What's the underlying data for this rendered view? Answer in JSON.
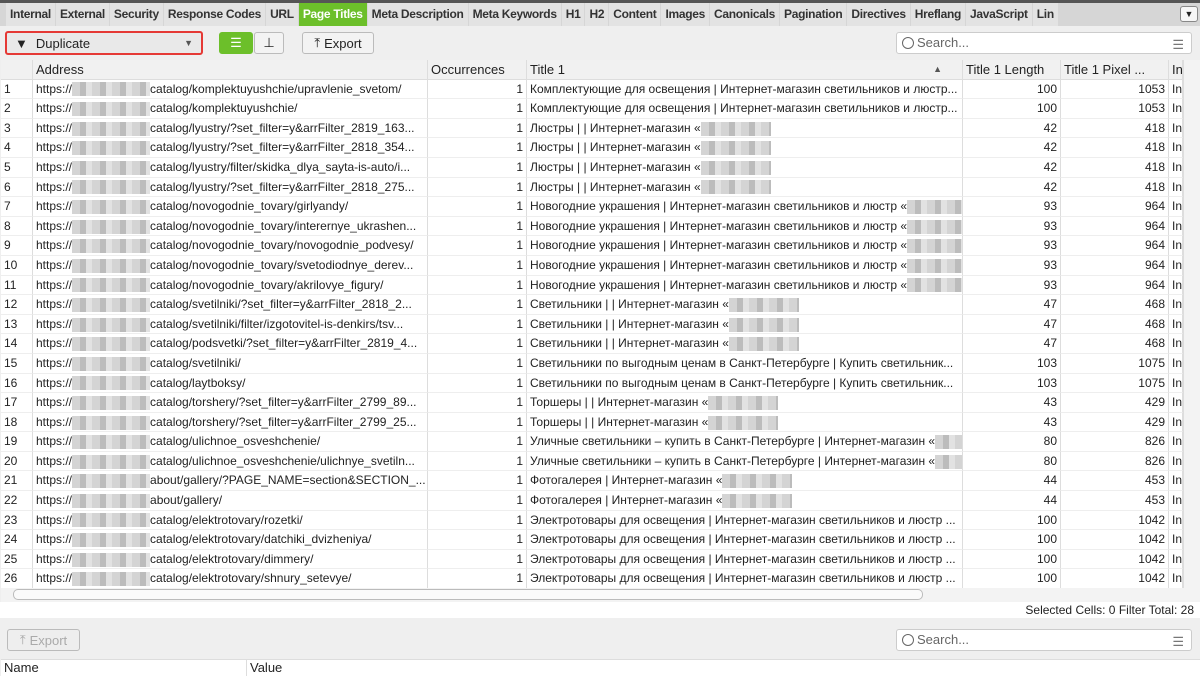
{
  "tabs": [
    "Internal",
    "External",
    "Security",
    "Response Codes",
    "URL",
    "Page Titles",
    "Meta Description",
    "Meta Keywords",
    "H1",
    "H2",
    "Content",
    "Images",
    "Canonicals",
    "Pagination",
    "Directives",
    "Hreflang",
    "JavaScript",
    "Lin"
  ],
  "active_tab": "Page Titles",
  "toolbar": {
    "filter": "Duplicate",
    "export": "Export",
    "search_placeholder": "Search..."
  },
  "columns": [
    "",
    "Address",
    "Occurrences",
    "Title 1",
    "Title 1 Length",
    "Title 1 Pixel ...",
    "In"
  ],
  "sort": {
    "column": "Title 1",
    "direction": "ascending"
  },
  "rows": [
    [
      1,
      "https://",
      "catalog/komplektuyushchie/upravlenie_svetom/",
      1,
      "Комплектующие для освещения | Интернет-магазин светильников и люстр...",
      false,
      100,
      1053
    ],
    [
      2,
      "https://",
      "catalog/komplektuyushchie/",
      1,
      "Комплектующие для освещения | Интернет-магазин светильников и люстр...",
      false,
      100,
      1053
    ],
    [
      3,
      "https://",
      "catalog/lyustry/?set_filter=y&arrFilter_2819_163...",
      1,
      "Люстры |  | Интернет-магазин «",
      true,
      42,
      418
    ],
    [
      4,
      "https://",
      "catalog/lyustry/?set_filter=y&arrFilter_2818_354...",
      1,
      "Люстры |  | Интернет-магазин «",
      true,
      42,
      418
    ],
    [
      5,
      "https://",
      "catalog/lyustry/filter/skidka_dlya_sayta-is-auto/i...",
      1,
      "Люстры |  | Интернет-магазин «",
      true,
      42,
      418
    ],
    [
      6,
      "https://",
      "catalog/lyustry/?set_filter=y&arrFilter_2818_275...",
      1,
      "Люстры |  | Интернет-магазин «",
      true,
      42,
      418
    ],
    [
      7,
      "https://",
      "catalog/novogodnie_tovary/girlyandy/",
      1,
      "Новогодние украшения | Интернет-магазин светильников и люстр «",
      true,
      93,
      964
    ],
    [
      8,
      "https://",
      "catalog/novogodnie_tovary/interernye_ukrashen...",
      1,
      "Новогодние украшения | Интернет-магазин светильников и люстр «",
      true,
      93,
      964
    ],
    [
      9,
      "https://",
      "catalog/novogodnie_tovary/novogodnie_podvesy/",
      1,
      "Новогодние украшения | Интернет-магазин светильников и люстр «",
      true,
      93,
      964
    ],
    [
      10,
      "https://",
      "catalog/novogodnie_tovary/svetodiodnye_derev...",
      1,
      "Новогодние украшения | Интернет-магазин светильников и люстр «",
      true,
      93,
      964
    ],
    [
      11,
      "https://",
      "catalog/novogodnie_tovary/akrilovye_figury/",
      1,
      "Новогодние украшения | Интернет-магазин светильников и люстр «",
      true,
      93,
      964
    ],
    [
      12,
      "https://",
      "catalog/svetilniki/?set_filter=y&arrFilter_2818_2...",
      1,
      "Светильники |  | Интернет-магазин «",
      true,
      47,
      468
    ],
    [
      13,
      "https://",
      "catalog/svetilniki/filter/izgotovitel-is-denkirs/tsv...",
      1,
      "Светильники |  | Интернет-магазин «",
      true,
      47,
      468
    ],
    [
      14,
      "https://",
      "catalog/podsvetki/?set_filter=y&arrFilter_2819_4...",
      1,
      "Светильники |  | Интернет-магазин «",
      true,
      47,
      468
    ],
    [
      15,
      "https://",
      "catalog/svetilniki/",
      1,
      "Светильники по выгодным ценам в Санкт-Петербурге | Купить светильник...",
      false,
      103,
      1075
    ],
    [
      16,
      "https://",
      "catalog/laytboksy/",
      1,
      "Светильники по выгодным ценам в Санкт-Петербурге | Купить светильник...",
      false,
      103,
      1075
    ],
    [
      17,
      "https://",
      "catalog/torshery/?set_filter=y&arrFilter_2799_89...",
      1,
      "Торшеры |  | Интернет-магазин «",
      true,
      43,
      429
    ],
    [
      18,
      "https://",
      "catalog/torshery/?set_filter=y&arrFilter_2799_25...",
      1,
      "Торшеры |  | Интернет-магазин «",
      true,
      43,
      429
    ],
    [
      19,
      "https://",
      "catalog/ulichnoe_osveshchenie/",
      1,
      "Уличные светильники – купить в Санкт-Петербурге | Интернет-магазин «",
      true,
      80,
      826
    ],
    [
      20,
      "https://",
      "catalog/ulichnoe_osveshchenie/ulichnye_svetiln...",
      1,
      "Уличные светильники – купить в Санкт-Петербурге | Интернет-магазин «",
      true,
      80,
      826
    ],
    [
      21,
      "https://",
      "about/gallery/?PAGE_NAME=section&SECTION_...",
      1,
      "Фотогалерея | Интернет-магазин «",
      true,
      44,
      453
    ],
    [
      22,
      "https://",
      "about/gallery/",
      1,
      "Фотогалерея | Интернет-магазин «",
      true,
      44,
      453
    ],
    [
      23,
      "https://",
      "catalog/elektrotovary/rozetki/",
      1,
      "Электротовары для освещения | Интернет-магазин светильников и люстр ...",
      false,
      100,
      1042
    ],
    [
      24,
      "https://",
      "catalog/elektrotovary/datchiki_dvizheniya/",
      1,
      "Электротовары для освещения | Интернет-магазин светильников и люстр ...",
      false,
      100,
      1042
    ],
    [
      25,
      "https://",
      "catalog/elektrotovary/dimmery/",
      1,
      "Электротовары для освещения | Интернет-магазин светильников и люстр ...",
      false,
      100,
      1042
    ],
    [
      26,
      "https://",
      "catalog/elektrotovary/shnury_setevye/",
      1,
      "Электротовары для освещения | Интернет-магазин светильников и люстр ...",
      false,
      100,
      1042
    ]
  ],
  "row_in_value": "In",
  "status": {
    "selected_label": "Selected Cells:",
    "selected": "0",
    "filter_label": "Filter Total:",
    "filter_total": "28"
  },
  "bottom": {
    "export": "Export",
    "search_placeholder": "Search...",
    "columns": [
      "Name",
      "Value"
    ]
  },
  "colors": {
    "accent": "#6cbf2a",
    "highlight": "#e53935"
  }
}
